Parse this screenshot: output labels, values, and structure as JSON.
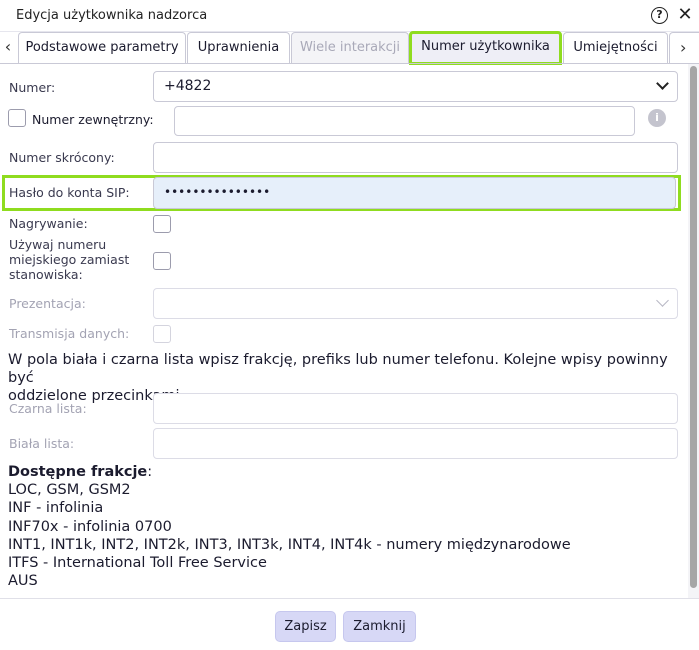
{
  "window": {
    "title": "Edycja użytkownika nadzorca",
    "help_icon": "?",
    "close_icon": "✕"
  },
  "tabs": {
    "prev_arrow": "‹",
    "next_arrow": "›",
    "items": [
      {
        "label": "Podstawowe parametry",
        "state": "normal"
      },
      {
        "label": "Uprawnienia",
        "state": "normal"
      },
      {
        "label": "Wiele interakcji",
        "state": "disabled"
      },
      {
        "label": "Numer użytkownika",
        "state": "active"
      },
      {
        "label": "Umiejętności",
        "state": "normal"
      }
    ]
  },
  "form": {
    "numer_label": "Numer:",
    "numer_value": "+4822",
    "zewnetrzny_label": "Numer zewnętrzny:",
    "zewnetrzny_checked": false,
    "zewnetrzny_value": "",
    "info_icon": "i",
    "skrocony_label": "Numer skrócony:",
    "skrocony_value": "",
    "haslo_label": "Hasło do konta SIP:",
    "haslo_value": "•••••••••••••••",
    "nagrywanie_label": "Nagrywanie:",
    "nagrywanie_checked": false,
    "miejski_label_1": "Używaj numeru",
    "miejski_label_2": "miejskiego zamiast",
    "miejski_label_3": "stanowiska:",
    "miejski_checked": false,
    "prezentacja_label": "Prezentacja:",
    "prezentacja_value": "",
    "transmisja_label": "Transmisja danych:",
    "transmisja_checked": false,
    "note_line_1": "W pola biała i czarna lista wpisz frakcję, prefiks lub numer telefonu. Kolejne wpisy powinny być",
    "note_line_2": "oddzielone przecinkami.",
    "czarna_label": "Czarna lista:",
    "czarna_value": "",
    "biala_label": "Biała lista:",
    "biala_value": ""
  },
  "frakcje": {
    "heading": "Dostępne frakcje",
    "colon": ":",
    "lines": [
      "LOC, GSM, GSM2",
      "INF - infolinia",
      "INF70x - infolinia 0700",
      "INT1, INT1k, INT2, INT2k, INT3, INT3k, INT4, INT4k - numery międzynarodowe",
      "ITFS - International Toll Free Service",
      "AUS"
    ]
  },
  "footer": {
    "save_label": "Zapisz",
    "close_label": "Zamknij"
  },
  "colors": {
    "highlight": "#8fdc1f",
    "button_bg": "#d7d8f6",
    "active_input_bg": "#e6effa"
  }
}
